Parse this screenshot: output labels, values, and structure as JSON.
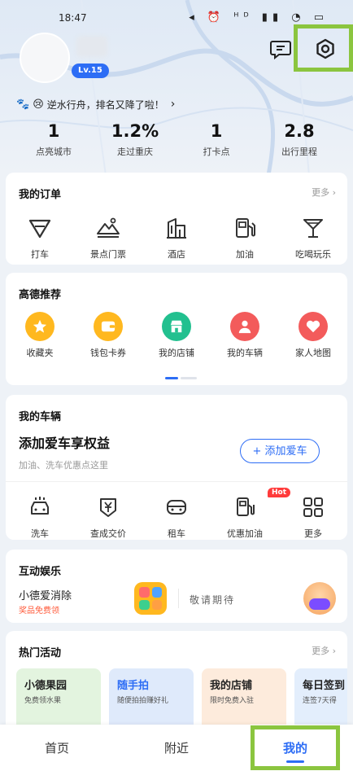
{
  "status_bar": {
    "time": "18:47",
    "icons": "◂ ⏰ ᴴᴰ ▮▮ ◔ ▭"
  },
  "profile": {
    "level": "Lv.15"
  },
  "banner": {
    "emoji1": "🐾",
    "emoji2": "😢",
    "text": "逆水行舟，排名又降了啦！",
    "chevron": "›"
  },
  "stats": [
    {
      "value": "1",
      "label": "点亮城市"
    },
    {
      "value": "1.2%",
      "label": "走过重庆"
    },
    {
      "value": "1",
      "label": "打卡点"
    },
    {
      "value": "2.8",
      "label": "出行里程"
    }
  ],
  "orders": {
    "title": "我的订单",
    "more": "更多 ›",
    "items": [
      {
        "label": "打车",
        "icon": "taxi-icon"
      },
      {
        "label": "景点门票",
        "icon": "ticket-icon"
      },
      {
        "label": "酒店",
        "icon": "hotel-icon"
      },
      {
        "label": "加油",
        "icon": "fuel-icon"
      },
      {
        "label": "吃喝玩乐",
        "icon": "cocktail-icon"
      }
    ]
  },
  "recommend": {
    "title": "高德推荐",
    "items": [
      {
        "label": "收藏夹",
        "icon": "star-icon",
        "color": "#ffb81f"
      },
      {
        "label": "钱包卡券",
        "icon": "wallet-icon",
        "color": "#ffb81f"
      },
      {
        "label": "我的店铺",
        "icon": "shop-icon",
        "color": "#22c08f"
      },
      {
        "label": "我的车辆",
        "icon": "person-icon",
        "color": "#f35b5b"
      },
      {
        "label": "家人地图",
        "icon": "family-heart-icon",
        "color": "#f35b5b"
      }
    ]
  },
  "vehicle": {
    "title": "我的车辆",
    "headline": "添加爱车享权益",
    "subtext": "加油、洗车优惠点这里",
    "add_button": "+ 添加爱车",
    "items": [
      {
        "label": "洗车",
        "icon": "car-wash-icon"
      },
      {
        "label": "查成交价",
        "icon": "price-tag-icon"
      },
      {
        "label": "租车",
        "icon": "car-rental-icon"
      },
      {
        "label": "优惠加油",
        "icon": "fuel-discount-icon",
        "badge": "Hot"
      },
      {
        "label": "更多",
        "icon": "grid-more-icon"
      }
    ]
  },
  "entertainment": {
    "title": "互动娱乐",
    "game_name": "小德爱消除",
    "game_sub": "奖品免费领",
    "coming": "敬请期待"
  },
  "activities": {
    "title": "热门活动",
    "more": "更多 ›",
    "tiles": [
      {
        "title": "小德果园",
        "sub": "免费领水果",
        "color": "#e3f4df"
      },
      {
        "title": "随手拍",
        "sub": "随便拍拍赚好礼",
        "color": "#dfeafb"
      },
      {
        "title": "我的店铺",
        "sub": "限时免费入驻",
        "color": "#fdebdc"
      },
      {
        "title": "每日签到",
        "sub": "连签7天得",
        "color": "#e3eefc"
      }
    ]
  },
  "bottom_nav": {
    "home": "首页",
    "nearby": "附近",
    "mine": "我的"
  }
}
